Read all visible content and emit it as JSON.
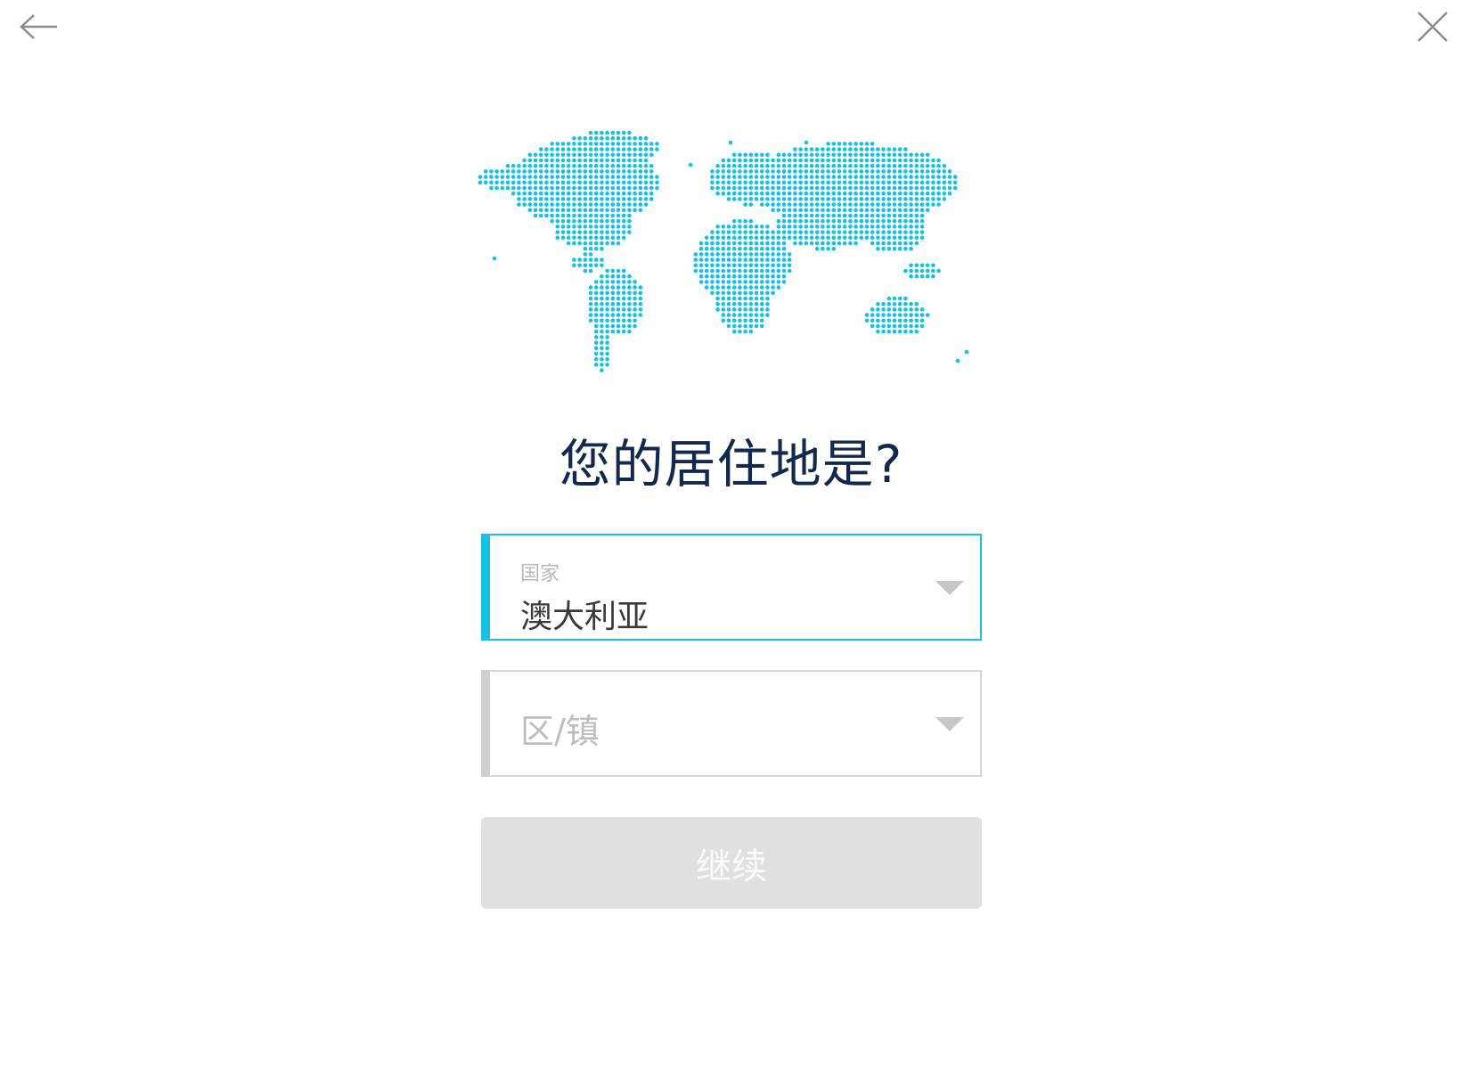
{
  "nav": {
    "back_icon": "arrow-left-icon",
    "close_icon": "close-icon"
  },
  "illustration": {
    "icon": "world-map-dots",
    "color": "#16c1e5"
  },
  "title": "您的居住地是?",
  "country_field": {
    "label": "国家",
    "value": "澳大利亚",
    "accent_color": "#16c1e5"
  },
  "district_field": {
    "placeholder": "区/镇"
  },
  "continue_button": {
    "label": "继续",
    "state": "disabled"
  }
}
